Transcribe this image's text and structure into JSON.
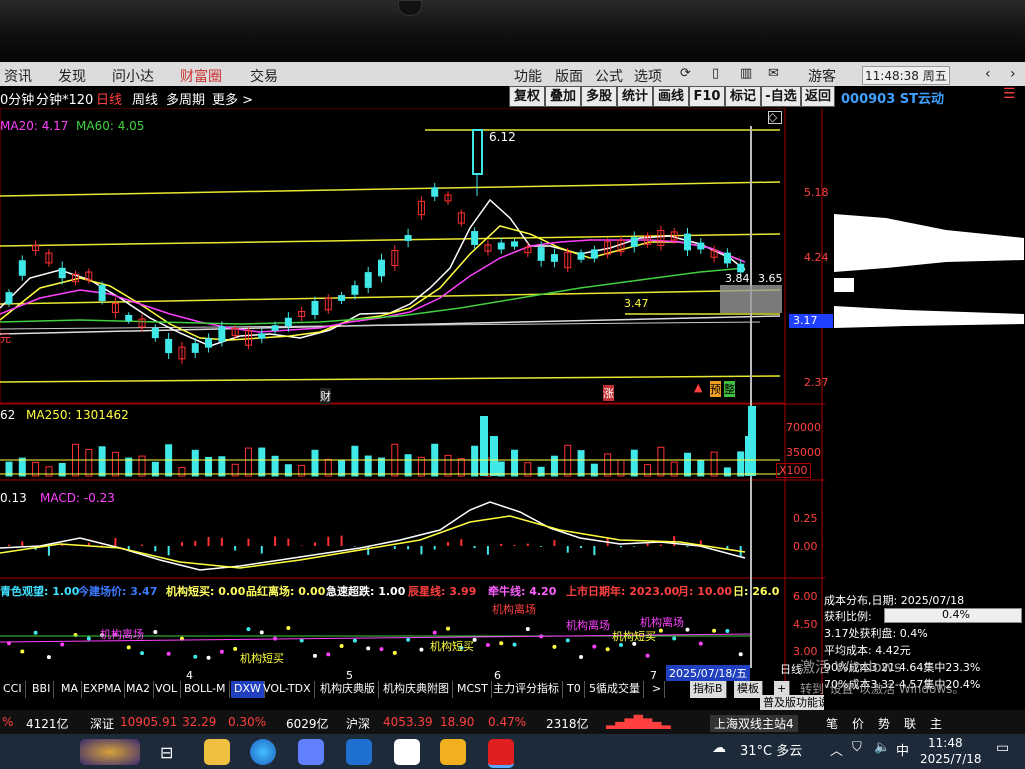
{
  "menu": {
    "left": [
      "资讯",
      "发现",
      "问小达",
      "财富圈",
      "交易"
    ],
    "right": [
      "功能",
      "版面",
      "公式",
      "选项"
    ],
    "user": "游客",
    "clock": "11:48:38 周五"
  },
  "toolbar": {
    "periods": [
      "0分钟",
      "分钟*120",
      "日线",
      "周线",
      "多周期",
      "更多 >"
    ],
    "buttons": [
      "复权",
      "叠加",
      "多股",
      "统计",
      "画线",
      "F10",
      "标记",
      "-自选",
      "返回"
    ],
    "stock": "000903 ST云动"
  },
  "ma": {
    "ma20": "MA20: 4.17",
    "ma60": "MA60: 4.05"
  },
  "price_axis": [
    "5.18",
    "4.24",
    "3.17",
    "2.37"
  ],
  "price_labels": {
    "high": "6.12",
    "level1": "3.84",
    "level2": "3.65",
    "level3": "3.47",
    "current": "3.17"
  },
  "markers": {
    "cai": "财",
    "zhang": "涨",
    "yu": "预",
    "zheng": "整"
  },
  "volume": {
    "label": "62",
    "ma250": "MA250: 1301462",
    "axis": [
      "70000",
      "35000"
    ],
    "unit": "X100"
  },
  "macd": {
    "left": "0.13",
    "label": "MACD: -0.23",
    "axis": [
      "0.25",
      "0.00"
    ]
  },
  "indicator": {
    "items": [
      {
        "text": "青色观望: 1.00",
        "color": "#40e0ff"
      },
      {
        "text": "今建场价: 3.47",
        "color": "#3a7bff"
      },
      {
        "text": "机构短买: 0.00",
        "color": "#ffff60"
      },
      {
        "text": "品红离场: 0.00",
        "color": "#ffff60"
      },
      {
        "text": "急速超跌: 1.00",
        "color": "#ffffff"
      },
      {
        "text": "辰星线: 3.99",
        "color": "#ff4040"
      },
      {
        "text": "牵牛线: 4.20",
        "color": "#ff60ff"
      },
      {
        "text": "上市日期年: 2023.00",
        "color": "#ff4040"
      },
      {
        "text": "月: 10.00",
        "color": "#ff4040"
      },
      {
        "text": "日: 26.0",
        "color": "#ffff60"
      }
    ],
    "axis": [
      "6.00",
      "4.50",
      "3.00"
    ],
    "annotations": [
      "机构离场",
      "机构离场",
      "机构离场",
      "机构短买",
      "机构短买",
      "机构短买",
      "机构离场"
    ]
  },
  "date_label": "2025/07/18/五",
  "month_labels": [
    "4",
    "5",
    "6",
    "7"
  ],
  "tabs": [
    "CCI",
    "BBI",
    "MA",
    "EXPMA",
    "MA2",
    "VOL",
    "BOLL-M",
    "DXW",
    "VOL-TDX",
    "机构庆典版",
    "机构庆典附图",
    "MCST",
    "主力评分指标",
    "T0",
    "5循成交量",
    ">"
  ],
  "side_tabs": [
    "指标B",
    "模板",
    "+",
    "普及版功能说明"
  ],
  "chip": {
    "date_label": "成本分布,日期: 2025/07/18",
    "profit_ratio_label": "获利比例:",
    "profit_ratio": "0.4%",
    "profit_at": "3.17处获利盘: 0.4%",
    "avg_cost": "平均成本: 4.42元",
    "c90": "90%成本3.21-4.64集中23.3%",
    "c70": "70%成本3.32-4.57集中20.4%"
  },
  "watermark": [
    "激活 Windows",
    "转到\"设置\"以激活 Windows。"
  ],
  "status": {
    "item1": "%",
    "item2": "4121亿",
    "sz_label": "深证",
    "sz_value": "10905.91",
    "sz_change": "32.29",
    "sz_pct": "0.30%",
    "sz_amount": "6029亿",
    "hs_label": "沪深",
    "hs_value": "4053.39",
    "hs_change": "18.90",
    "hs_pct": "0.47%",
    "hs_amount": "2318亿",
    "server": "上海双线主站4",
    "right_tabs": [
      "笔",
      "价",
      "势",
      "联",
      "主"
    ]
  },
  "taskbar": {
    "weather": "31°C 多云",
    "time": "11:48",
    "date": "2025/7/18",
    "ime": "中"
  },
  "colors": {
    "up": "#ff3030",
    "down": "#40e8e8",
    "yellow": "#ffff40",
    "magenta": "#ff40ff",
    "green": "#40d040"
  }
}
